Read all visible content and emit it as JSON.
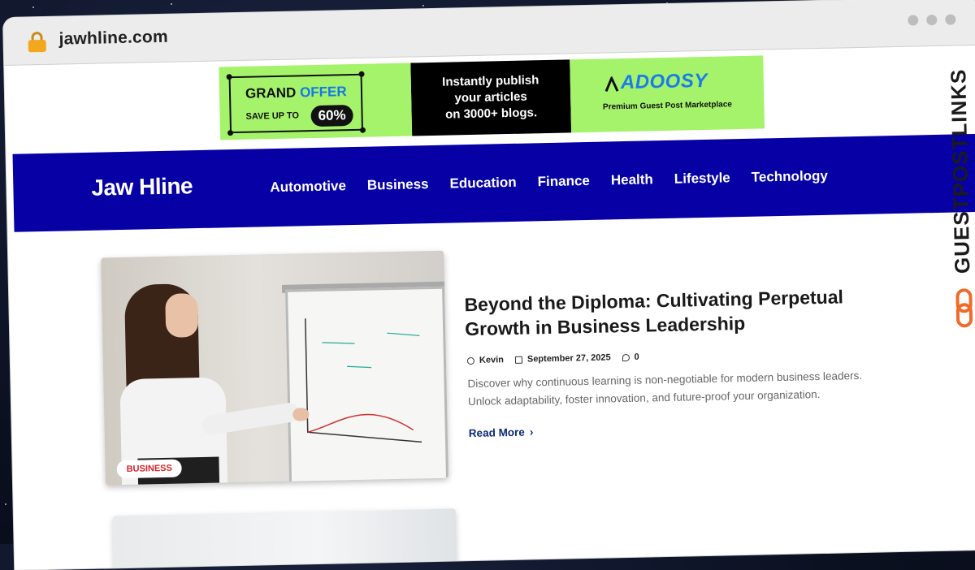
{
  "browser": {
    "url": "jawhline.com"
  },
  "ad": {
    "grand": "GRAND",
    "offer": "OFFER",
    "save_up_to": "SAVE UP TO",
    "percent": "60%",
    "middle_line1": "Instantly publish",
    "middle_line2": "your articles",
    "middle_line3": "on 3000+ blogs.",
    "brand": "ADOOSY",
    "tagline": "Premium Guest Post Marketplace"
  },
  "site": {
    "logo": "Jaw Hline",
    "menu": [
      "Automotive",
      "Business",
      "Education",
      "Finance",
      "Health",
      "Lifestyle",
      "Technology"
    ]
  },
  "article": {
    "category": "BUSINESS",
    "title": "Beyond the Diploma: Cultivating Perpetual Growth in Business Leadership",
    "author": "Kevin",
    "date": "September 27, 2025",
    "comments": "0",
    "excerpt": "Discover why continuous learning is non-negotiable for modern business leaders. Unlock adaptability, foster innovation, and future-proof your organization.",
    "read_more": "Read More"
  },
  "watermark": {
    "text": "GUESTPOSTLINKS"
  },
  "colors": {
    "nav": "#0600a5",
    "ad_green": "#a5f36b",
    "tag_red": "#d3262a",
    "watermark_icon": "#f06a2a"
  }
}
